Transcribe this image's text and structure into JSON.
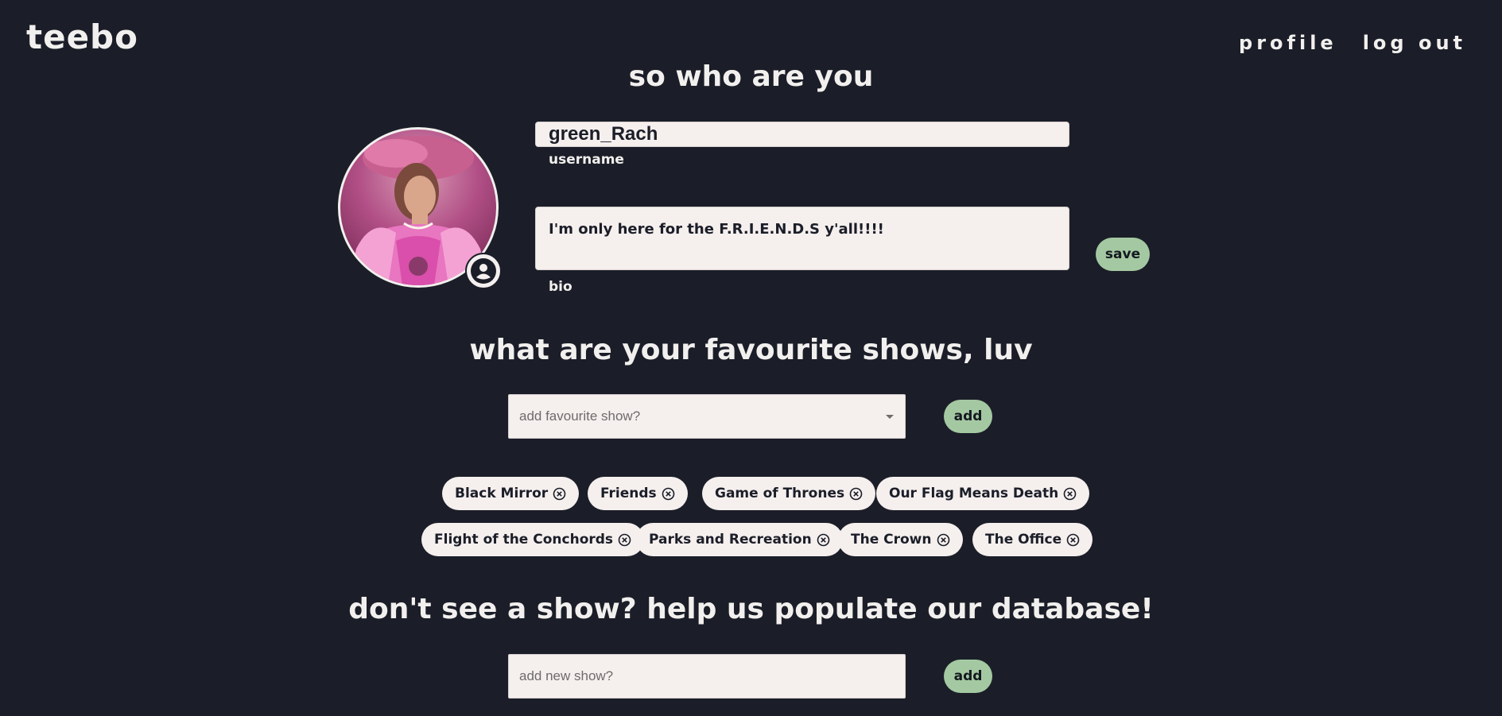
{
  "header": {
    "logo": "teebo",
    "nav": [
      {
        "label": "profile"
      },
      {
        "label": "log out"
      }
    ]
  },
  "profile": {
    "heading": "so who are you",
    "username_value": "green_Rach",
    "username_label": "username",
    "bio_value": "I'm only here for the F.R.I.E.N.D.S y'all!!!!",
    "bio_label": "bio",
    "save_label": "save"
  },
  "favourites": {
    "heading": "what are your favourite shows, luv",
    "select_placeholder": "add favourite show?",
    "add_label": "add",
    "shows": [
      {
        "label": "Black Mirror"
      },
      {
        "label": "Friends"
      },
      {
        "label": "Game of Thrones"
      },
      {
        "label": "Our Flag Means Death"
      },
      {
        "label": "Flight of the Conchords"
      },
      {
        "label": "Parks and Recreation"
      },
      {
        "label": "The Crown"
      },
      {
        "label": "The Office"
      }
    ]
  },
  "new_show": {
    "heading": "don't see a show? help us populate our database!",
    "placeholder": "add new show?",
    "add_label": "add"
  },
  "colors": {
    "background": "#1b1e28",
    "text": "#f2f0ee",
    "button": "#a4c9a2",
    "chip": "#f5efee"
  }
}
